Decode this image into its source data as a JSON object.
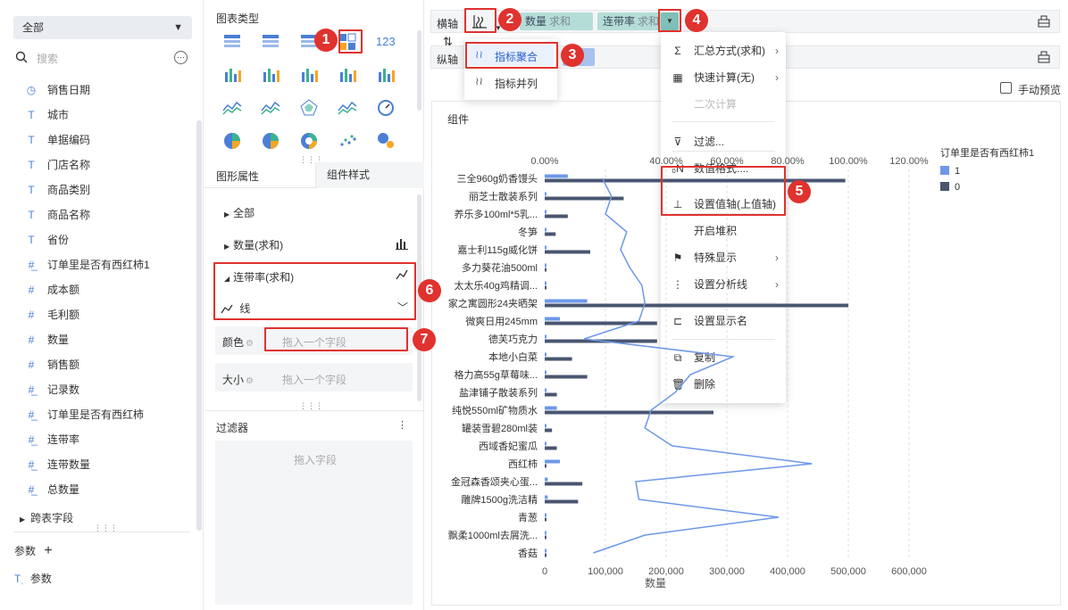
{
  "left": {
    "dropdown_label": "全部",
    "search_placeholder": "搜索",
    "fields": [
      {
        "icon": "clock",
        "label": "销售日期"
      },
      {
        "icon": "T",
        "label": "城市"
      },
      {
        "icon": "T",
        "label": "单据编码"
      },
      {
        "icon": "T",
        "label": "门店名称"
      },
      {
        "icon": "T",
        "label": "商品类别"
      },
      {
        "icon": "T",
        "label": "商品名称"
      },
      {
        "icon": "T",
        "label": "省份"
      },
      {
        "icon": "#f",
        "label": "订单里是否有西红柿1"
      },
      {
        "icon": "#",
        "label": "成本额"
      },
      {
        "icon": "#",
        "label": "毛利额"
      },
      {
        "icon": "#",
        "label": "数量"
      },
      {
        "icon": "#",
        "label": "销售额"
      },
      {
        "icon": "#f",
        "label": "记录数"
      },
      {
        "icon": "#f",
        "label": "订单里是否有西红柿"
      },
      {
        "icon": "#f",
        "label": "连带率"
      },
      {
        "icon": "#f",
        "label": "连带数量"
      },
      {
        "icon": "#f",
        "label": "总数量"
      }
    ],
    "cross_table": "跨表字段",
    "params_label": "参数",
    "param_item": "参数"
  },
  "mid": {
    "chart_type_title": "图表类型",
    "tab_graphic": "图形属性",
    "tab_component": "组件样式",
    "all": "全部",
    "qty_sum": "数量(求和)",
    "rate_sum": "连带率(求和)",
    "line_label": "线",
    "color_label": "颜色",
    "size_label": "大小",
    "drag_field": "拖入一个字段",
    "drag_field2": "拖入一个字段",
    "filter_title": "过滤器",
    "filter_drop": "拖入字段"
  },
  "right": {
    "x_axis_label": "横轴",
    "y_axis_label": "纵轴",
    "pill_qty": "数量",
    "pill_qty_sub": "求和",
    "pill_rate": "连带率",
    "pill_rate_sub": "求和",
    "submenu_aggregate": "指标聚合",
    "submenu_parallel": "指标并列",
    "manual_preview": "手动预览",
    "component_label": "组件",
    "context_menu": [
      {
        "icon": "Σ",
        "label": "汇总方式(求和)",
        "arrow": true,
        "disabled": false
      },
      {
        "icon": "▦",
        "label": "快速计算(无)",
        "arrow": true,
        "disabled": false
      },
      {
        "icon": "",
        "label": "二次计算",
        "arrow": false,
        "disabled": true
      },
      {
        "icon": "⊽",
        "label": "过滤...",
        "arrow": false,
        "disabled": false
      },
      {
        "icon": "₀N",
        "label": "数值格式....",
        "arrow": false,
        "disabled": false
      },
      {
        "icon": "⊥",
        "label": "设置值轴(上值轴)",
        "arrow": false,
        "disabled": false
      },
      {
        "icon": "",
        "label": "开启堆积",
        "arrow": false,
        "disabled": false
      },
      {
        "icon": "⚑",
        "label": "特殊显示",
        "arrow": true,
        "disabled": false
      },
      {
        "icon": "⋮",
        "label": "设置分析线",
        "arrow": true,
        "disabled": false
      },
      {
        "icon": "⊏",
        "label": "设置显示名",
        "arrow": false,
        "disabled": false
      },
      {
        "icon": "⧉",
        "label": "复制",
        "arrow": false,
        "disabled": false
      },
      {
        "icon": "🗑",
        "label": "删除",
        "arrow": false,
        "disabled": false
      }
    ],
    "badges": [
      "1",
      "2",
      "3",
      "4",
      "5",
      "6",
      "7"
    ]
  },
  "chart_data": {
    "type": "bar",
    "categories": [
      "三全960g奶香馒头",
      "丽芝士散装系列",
      "养乐多100ml*5乳...",
      "冬笋",
      "嘉士利115g威化饼",
      "多力葵花油500ml",
      "太太乐40g鸡精调...",
      "家之寓圆形24夹晒架",
      "微爽日用245mm",
      "德芙巧克力",
      "本地小白菜",
      "格力高55g草莓味...",
      "盐津铺子散装系列",
      "纯悦550ml矿物质水",
      "罐装雪碧280ml装",
      "西域香妃蜜瓜",
      "西红柿",
      "金冠森香颂夹心蛋...",
      "雕牌1500g洗洁精",
      "青葱",
      "飘柔1000ml去屑洗...",
      "香菇"
    ],
    "series": [
      {
        "name": "1",
        "color": "#6d98e8",
        "values": [
          38000,
          0,
          0,
          0,
          0,
          0,
          0,
          70000,
          25000,
          3000,
          0,
          3000,
          0,
          20000,
          0,
          0,
          25000,
          5000,
          5000,
          0,
          0,
          0
        ]
      },
      {
        "name": "0",
        "color": "#4a5670",
        "values": [
          495000,
          130000,
          38000,
          18000,
          75000,
          3000,
          3000,
          500000,
          185000,
          185000,
          45000,
          70000,
          20000,
          278000,
          12000,
          20000,
          0,
          62000,
          55000,
          2000,
          2000,
          2000
        ]
      }
    ],
    "line_values": [
      0.19,
      0.22,
      0.2,
      0.27,
      0.25,
      0.28,
      0.32,
      0.33,
      0.31,
      0.13,
      0.62,
      0.48,
      0.43,
      0.35,
      0.33,
      0.42,
      0.88,
      0.3,
      0.31,
      0.77,
      0.33,
      0.16
    ],
    "x_ticks": [
      "0",
      "100,000",
      "200,000",
      "300,000",
      "400,000",
      "500,000",
      "600,000"
    ],
    "xlabel": "数量",
    "xlim": [
      0,
      600000
    ],
    "top_ticks": [
      "0.00%",
      "40.00%",
      "60.00%",
      "80.00%",
      "100.00%",
      "120.00%"
    ],
    "top_xlim": [
      0,
      1.2
    ],
    "legend_title": "订单里是否有西红柿1",
    "legend": [
      "1",
      "0"
    ]
  }
}
